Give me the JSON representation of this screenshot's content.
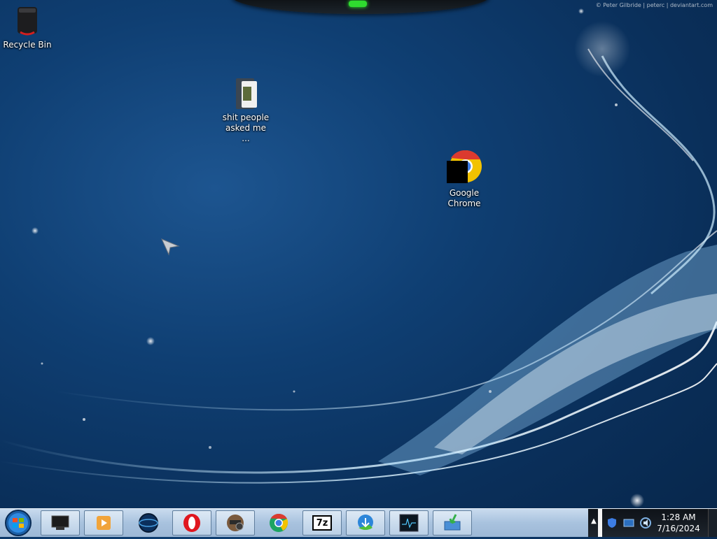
{
  "credit": "© Peter Gilbride | peterc | deviantart.com",
  "desktop_icons": {
    "recycle_bin": "Recycle Bin",
    "folder": "shit people asked me ...",
    "chrome": "Google Chrome"
  },
  "taskbar": {
    "start": "start-orb-icon",
    "pinned": [
      "computer-monitor-icon",
      "media-player-icon",
      "planet-globe-icon",
      "opera-icon",
      "webcam-app-icon",
      "chrome-icon",
      "7zip-icon",
      "download-manager-icon",
      "oscilloscope-icon",
      "install-arrow-icon"
    ],
    "seven_zip_label": "7z"
  },
  "tray": {
    "time": "1:28 AM",
    "date": "7/16/2024",
    "icons": [
      "chevron-up-icon",
      "shield-icon",
      "network-icon",
      "volume-icon"
    ]
  },
  "colors": {
    "wallpaper_base": "#0f3f73",
    "taskbar": "#b9cfe6",
    "tray": "#0e1218",
    "gadget_led": "#2fdc2f"
  }
}
